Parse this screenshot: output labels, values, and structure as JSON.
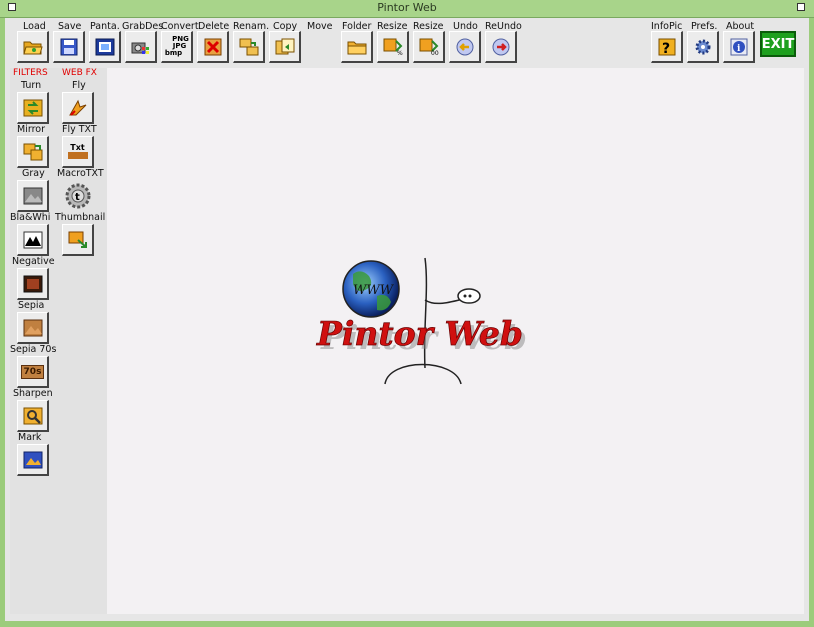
{
  "window": {
    "title": "Pintor Web"
  },
  "toolbar": {
    "left": [
      {
        "label": "Load",
        "icon": "folder-open-icon"
      },
      {
        "label": "Save",
        "icon": "floppy-disk-icon"
      },
      {
        "label": "Panta.",
        "icon": "screen-capture-icon"
      },
      {
        "label": "GrabDes",
        "icon": "camera-icon"
      },
      {
        "label": "Convert",
        "icon": "format-convert-icon",
        "icon_text": [
          "PNG",
          "JPG",
          "bmp"
        ]
      },
      {
        "label": "Delete",
        "icon": "delete-x-icon"
      },
      {
        "label": "Renam.",
        "icon": "rename-icon"
      },
      {
        "label": "Copy",
        "icon": "copy-icon"
      },
      {
        "label": "Move",
        "icon": ""
      }
    ],
    "mid": [
      {
        "label": "Folder",
        "icon": "folder-icon"
      },
      {
        "label": "Resize",
        "icon": "resize-percent-icon"
      },
      {
        "label": "Resize",
        "icon": "resize-pixels-icon"
      },
      {
        "label": "Undo",
        "icon": "undo-arrow-icon"
      },
      {
        "label": "ReUndo",
        "icon": "redo-arrow-icon"
      }
    ],
    "right": [
      {
        "label": "InfoPic",
        "icon": "question-icon"
      },
      {
        "label": "Prefs.",
        "icon": "gear-icon"
      },
      {
        "label": "About",
        "icon": "info-icon"
      }
    ],
    "exit_label": "EXIT"
  },
  "sidebar": {
    "filters_header": "FILTERS",
    "webfx_header": "WEB FX",
    "filters": [
      {
        "label": "Turn",
        "icon": "turn-icon"
      },
      {
        "label": "Mirror",
        "icon": "mirror-icon"
      },
      {
        "label": "Gray",
        "icon": "gray-icon"
      },
      {
        "label": "Bla&Whi",
        "icon": "black-white-icon"
      },
      {
        "label": "Negative",
        "icon": "negative-icon"
      },
      {
        "label": "Sepia",
        "icon": "sepia-icon"
      },
      {
        "label": "Sepia 70s",
        "icon": "sepia-70s-icon",
        "icon_text": "70s"
      },
      {
        "label": "Sharpen",
        "icon": "sharpen-icon"
      },
      {
        "label": "Mark",
        "icon": "mark-icon"
      }
    ],
    "webfx": [
      {
        "label": "Fly",
        "icon": "fly-icon"
      },
      {
        "label": "Fly TXT",
        "icon": "fly-txt-icon",
        "icon_text": "Txt"
      },
      {
        "label": "MacroTXT",
        "icon": "macro-txt-icon",
        "icon_text": "t"
      },
      {
        "label": "Thumbnail",
        "icon": "thumbnail-icon"
      }
    ]
  },
  "logo": {
    "text": "Pintor Web",
    "globe_text": "WWW"
  },
  "colors": {
    "titlebar": "#a8d48a",
    "frame": "#9ccc7c",
    "filters_header": "#e00000",
    "exit": "#1ea01e",
    "logo_red": "#d01010"
  }
}
